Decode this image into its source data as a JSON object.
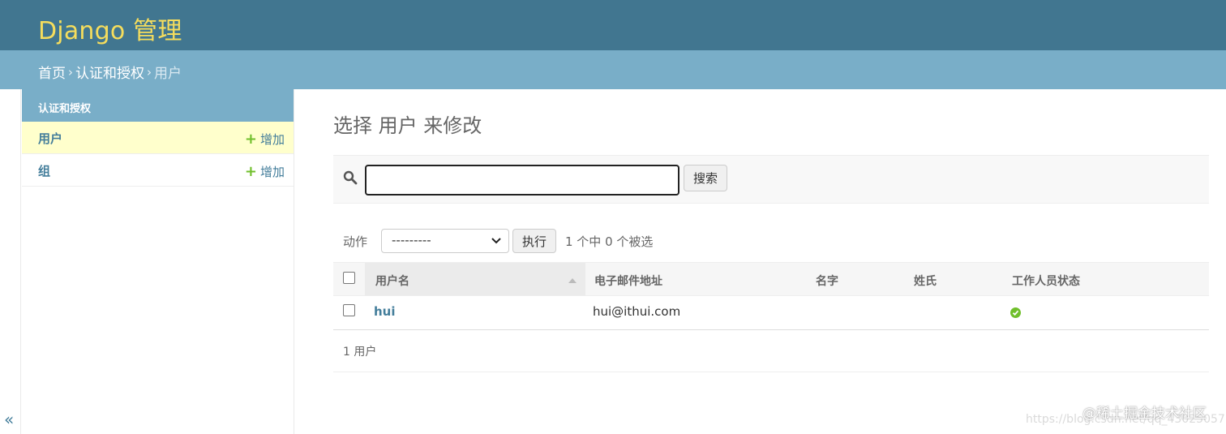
{
  "header": {
    "branding": "Django 管理"
  },
  "breadcrumbs": {
    "home": "首页",
    "app": "认证和授权",
    "current": "用户",
    "separator": "›"
  },
  "sidebar_toggle": {
    "glyph": "«"
  },
  "nav": {
    "caption": "认证和授权",
    "models": [
      {
        "label": "用户",
        "add_label": "增加",
        "current": true
      },
      {
        "label": "组",
        "add_label": "增加",
        "current": false
      }
    ]
  },
  "content": {
    "title": "选择 用户 来修改"
  },
  "search": {
    "value": "",
    "button_label": "搜索"
  },
  "actions": {
    "label": "动作",
    "selected_option": "---------",
    "go_label": "执行",
    "counter": "1 个中 0 个被选"
  },
  "table": {
    "columns": [
      "用户名",
      "电子邮件地址",
      "名字",
      "姓氏",
      "工作人员状态"
    ],
    "rows": [
      {
        "username": "hui",
        "email": "hui@ithui.com",
        "first_name": "",
        "last_name": "",
        "is_staff": true
      }
    ]
  },
  "paginator": {
    "text": "1 用户"
  },
  "watermark": {
    "text": "@稀土掘金技术社区",
    "url": "https://blog.csdn.net/qq_43025057"
  },
  "colors": {
    "header_bg": "#417690",
    "branding": "#f5dd5d",
    "breadcrumb_bg": "#79aec8",
    "link": "#447e9b",
    "current_row": "#ffffcc",
    "success": "#70bf2b"
  }
}
